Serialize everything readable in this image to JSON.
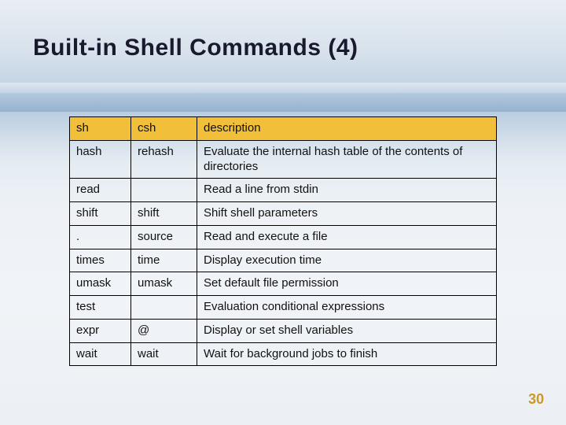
{
  "title": "Built-in Shell Commands (4)",
  "page_number": "30",
  "chart_data": {
    "type": "table",
    "headers": [
      "sh",
      "csh",
      "description"
    ],
    "rows": [
      [
        "hash",
        "rehash",
        "Evaluate the internal hash table of the contents of directories"
      ],
      [
        "read",
        "",
        "Read a line from stdin"
      ],
      [
        "shift",
        "shift",
        "Shift shell parameters"
      ],
      [
        ".",
        "source",
        "Read and execute a file"
      ],
      [
        "times",
        "time",
        "Display execution time"
      ],
      [
        "umask",
        "umask",
        "Set default file permission"
      ],
      [
        "test",
        "",
        "Evaluation conditional expressions"
      ],
      [
        "expr",
        "@",
        "Display or set shell variables"
      ],
      [
        "wait",
        "wait",
        "Wait for background jobs to finish"
      ]
    ]
  }
}
